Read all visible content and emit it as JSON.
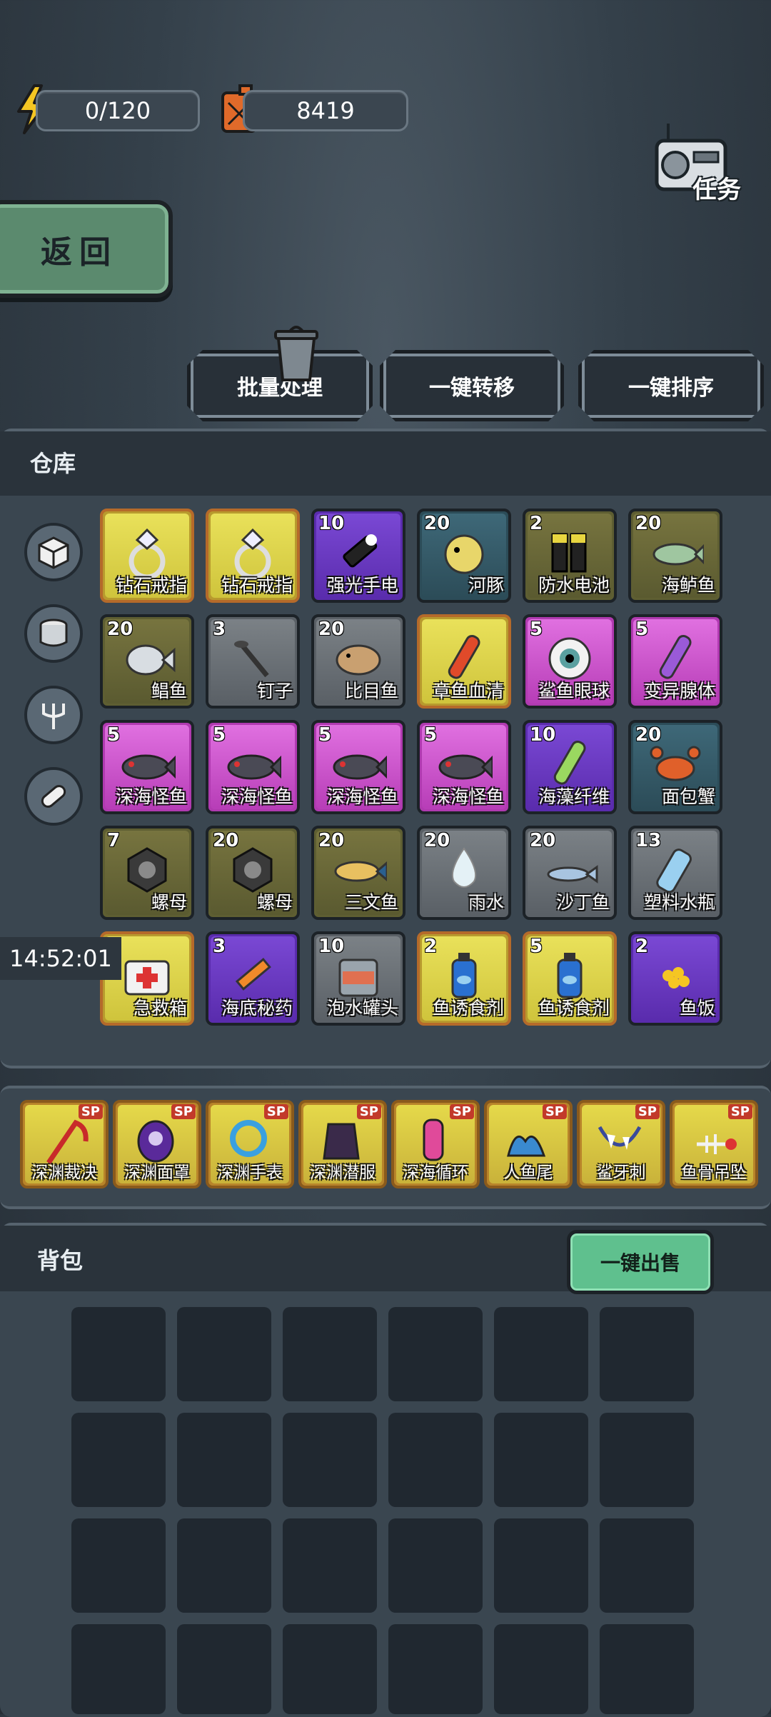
{
  "resources": {
    "energy": "0/120",
    "fuel": "8419"
  },
  "back_label": "返回",
  "task_label": "任务",
  "actions": {
    "batch": "批量处理",
    "transfer": "一键转移",
    "sort": "一键排序"
  },
  "warehouse": {
    "title": "仓库",
    "timer": "14:52:01",
    "items": [
      {
        "name": "钻石戒指",
        "count": "",
        "rarity": "yellow",
        "icon": "ring-icon"
      },
      {
        "name": "钻石戒指",
        "count": "",
        "rarity": "yellow",
        "icon": "ring-icon"
      },
      {
        "name": "强光手电",
        "count": "10",
        "rarity": "purple",
        "icon": "flashlight-icon"
      },
      {
        "name": "河豚",
        "count": "20",
        "rarity": "teal",
        "icon": "pufferfish-icon"
      },
      {
        "name": "防水电池",
        "count": "2",
        "rarity": "olive",
        "icon": "battery-icon"
      },
      {
        "name": "海鲈鱼",
        "count": "20",
        "rarity": "olive",
        "icon": "bass-fish-icon"
      },
      {
        "name": "鲳鱼",
        "count": "20",
        "rarity": "olive",
        "icon": "pomfret-icon"
      },
      {
        "name": "钉子",
        "count": "3",
        "rarity": "gray",
        "icon": "nail-icon"
      },
      {
        "name": "比目鱼",
        "count": "20",
        "rarity": "gray",
        "icon": "flatfish-icon"
      },
      {
        "name": "章鱼血清",
        "count": "",
        "rarity": "yellow",
        "icon": "serum-vial-icon"
      },
      {
        "name": "鲨鱼眼球",
        "count": "5",
        "rarity": "pink",
        "icon": "eyeball-icon"
      },
      {
        "name": "变异腺体",
        "count": "5",
        "rarity": "pink",
        "icon": "gland-vial-icon"
      },
      {
        "name": "深海怪鱼",
        "count": "5",
        "rarity": "pink",
        "icon": "monster-fish-icon"
      },
      {
        "name": "深海怪鱼",
        "count": "5",
        "rarity": "pink",
        "icon": "monster-fish-icon"
      },
      {
        "name": "深海怪鱼",
        "count": "5",
        "rarity": "pink",
        "icon": "monster-fish-icon"
      },
      {
        "name": "深海怪鱼",
        "count": "5",
        "rarity": "pink",
        "icon": "monster-fish-icon"
      },
      {
        "name": "海藻纤维",
        "count": "10",
        "rarity": "purple",
        "icon": "seaweed-tube-icon"
      },
      {
        "name": "面包蟹",
        "count": "20",
        "rarity": "teal",
        "icon": "crab-icon"
      },
      {
        "name": "螺母",
        "count": "7",
        "rarity": "olive",
        "icon": "nut-icon"
      },
      {
        "name": "螺母",
        "count": "20",
        "rarity": "olive",
        "icon": "nut-icon"
      },
      {
        "name": "三文鱼",
        "count": "20",
        "rarity": "olive",
        "icon": "salmon-icon"
      },
      {
        "name": "雨水",
        "count": "20",
        "rarity": "gray",
        "icon": "water-drop-icon"
      },
      {
        "name": "沙丁鱼",
        "count": "20",
        "rarity": "gray",
        "icon": "sardine-icon"
      },
      {
        "name": "塑料水瓶",
        "count": "13",
        "rarity": "gray",
        "icon": "bottle-icon"
      },
      {
        "name": "急救箱",
        "count": "3",
        "rarity": "yellow",
        "icon": "first-aid-icon"
      },
      {
        "name": "海底秘药",
        "count": "3",
        "rarity": "purple",
        "icon": "syringe-icon"
      },
      {
        "name": "泡水罐头",
        "count": "10",
        "rarity": "gray",
        "icon": "can-icon"
      },
      {
        "name": "鱼诱食剂",
        "count": "2",
        "rarity": "yellow",
        "icon": "bait-bottle-icon"
      },
      {
        "name": "鱼诱食剂",
        "count": "5",
        "rarity": "yellow",
        "icon": "bait-bottle-icon"
      },
      {
        "name": "鱼饭",
        "count": "2",
        "rarity": "purple",
        "icon": "fish-roe-icon"
      }
    ]
  },
  "equipment": [
    {
      "name": "深渊裁决",
      "badge": "SP",
      "icon": "scythe-icon"
    },
    {
      "name": "深渊面罩",
      "badge": "SP",
      "icon": "mask-icon"
    },
    {
      "name": "深渊手表",
      "badge": "SP",
      "icon": "watch-icon"
    },
    {
      "name": "深渊潜服",
      "badge": "SP",
      "icon": "dive-suit-icon"
    },
    {
      "name": "深海循环",
      "badge": "SP",
      "icon": "rebreather-icon"
    },
    {
      "name": "人鱼尾",
      "badge": "SP",
      "icon": "fins-icon"
    },
    {
      "name": "鲨牙刺",
      "badge": "SP",
      "icon": "shark-teeth-icon"
    },
    {
      "name": "鱼骨吊坠",
      "badge": "SP",
      "icon": "fishbone-pendant-icon"
    }
  ],
  "backpack": {
    "title": "背包",
    "sell_label": "一键出售"
  },
  "colors": {
    "accent_green": "#5fc08e",
    "panel": "#3a4650",
    "sp_gold": "#e5d94a"
  }
}
